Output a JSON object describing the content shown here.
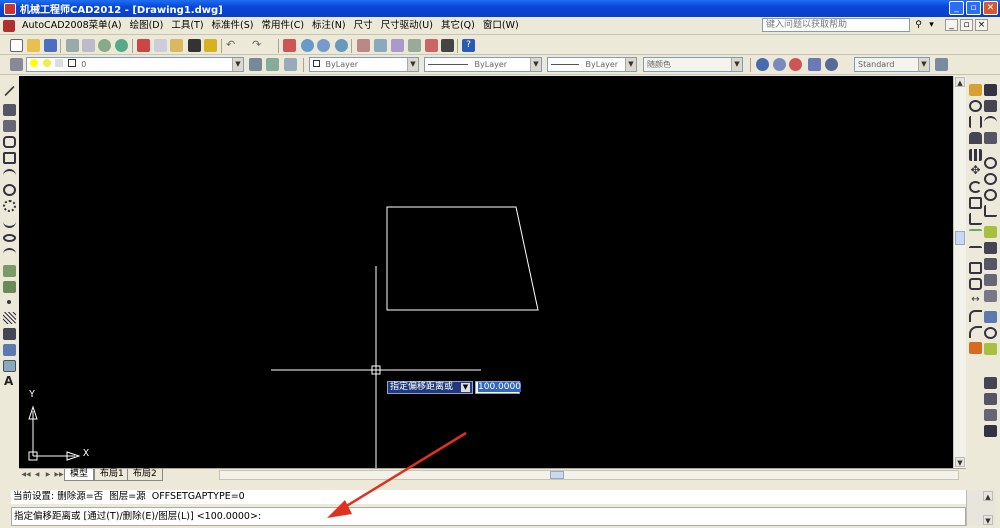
{
  "window": {
    "title": "机械工程师CAD2012 - [Drawing1.dwg]",
    "min": "_",
    "max": "▫",
    "close": "✕"
  },
  "menu": {
    "items": [
      "AutoCAD2008菜单(A)",
      "绘图(D)",
      "工具(T)",
      "标准件(S)",
      "常用件(C)",
      "标注(N)",
      "尺寸",
      "尺寸驱动(U)",
      "其它(Q)",
      "窗口(W)"
    ],
    "help_placeholder": "键入问题以获取帮助"
  },
  "toolbar2": {
    "layer_value": "0",
    "color_value": "ByLayer",
    "linetype_value": "ByLayer",
    "lineweight_value": "ByLayer",
    "plotstyle_value": "随颜色",
    "textstyle_value": "Standard"
  },
  "canvas": {
    "ucs_y": "Y",
    "ucs_x": "X",
    "dyn_prompt": "指定偏移距离或",
    "dyn_value": "100.0000"
  },
  "tabs": [
    "模型",
    "布局1",
    "布局2"
  ],
  "command": {
    "history": "当前设置: 删除源=否  图层=源  OFFSETGAPTYPE=0",
    "prompt": "指定偏移距离或 [通过(T)/删除(E)/图层(L)] <100.0000>:"
  },
  "left_toolbar": {
    "text_tool": "A"
  },
  "colors": {
    "canvas_bg": "#000000",
    "title_blue": "#0a3fc5",
    "ui_bg": "#ece9d8",
    "arrow_red": "#e03020"
  }
}
